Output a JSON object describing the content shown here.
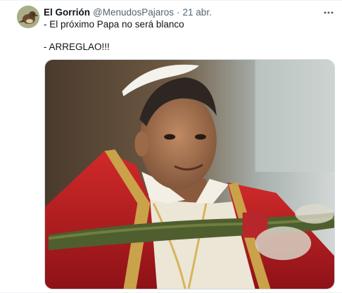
{
  "tweet": {
    "author_name": "El Gorrión",
    "author_handle": "@MenudosPajaros",
    "separator": "·",
    "timestamp": "21 abr.",
    "text_lines": [
      "- El próximo Papa no será blanco",
      "- ARREGLAO!!!"
    ],
    "avatar_icon": "sparrow-avatar",
    "more_icon": "more-horizontal-icon"
  },
  "media": {
    "kind": "photo",
    "description_icon": "pope-photo"
  },
  "colors": {
    "text": "#0f1419",
    "secondary": "#536471",
    "border": "#cfd9de",
    "vestment_red": "#c01b22",
    "gold": "#c9a24a"
  }
}
